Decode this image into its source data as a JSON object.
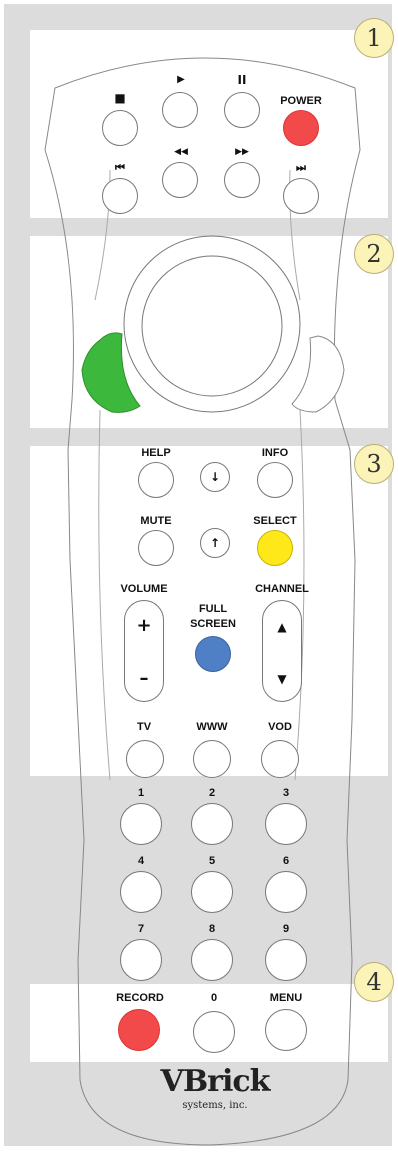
{
  "transport": {
    "stop_icon": "■",
    "play_icon": "▶",
    "pause_icon": "II",
    "power_label": "POWER",
    "skip_back_icon": "⏮",
    "rewind_icon": "◀◀",
    "fast_forward_icon": "▶▶",
    "skip_forward_icon": "⏭"
  },
  "badges": [
    "1",
    "2",
    "3",
    "4"
  ],
  "controls": {
    "help_label": "HELP",
    "info_label": "INFO",
    "down_arrow_icon": "↓",
    "up_arrow_icon": "↑",
    "mute_label": "MUTE",
    "select_label": "SELECT",
    "volume_label": "VOLUME",
    "fullscreen_label_1": "FULL",
    "fullscreen_label_2": "SCREEN",
    "channel_label": "CHANNEL",
    "volume_plus": "+",
    "volume_minus": "–",
    "channel_up_icon": "▲",
    "channel_down_icon": "▼",
    "tv_label": "TV",
    "www_label": "WWW",
    "vod_label": "VOD"
  },
  "keypad": [
    "1",
    "2",
    "3",
    "4",
    "5",
    "6",
    "7",
    "8",
    "9"
  ],
  "bottom": {
    "record_label": "RECORD",
    "zero_label": "0",
    "menu_label": "MENU"
  },
  "brand": {
    "name": "VBrick",
    "sub": "systems, inc."
  },
  "colors": {
    "power": "#f24a4a",
    "select": "#ffe81a",
    "fullscreen": "#4f7fc4",
    "record": "#f24a4a",
    "green_key": "#3cb83c",
    "badge": "#fbf3b8",
    "background": "#dcdcdc"
  }
}
